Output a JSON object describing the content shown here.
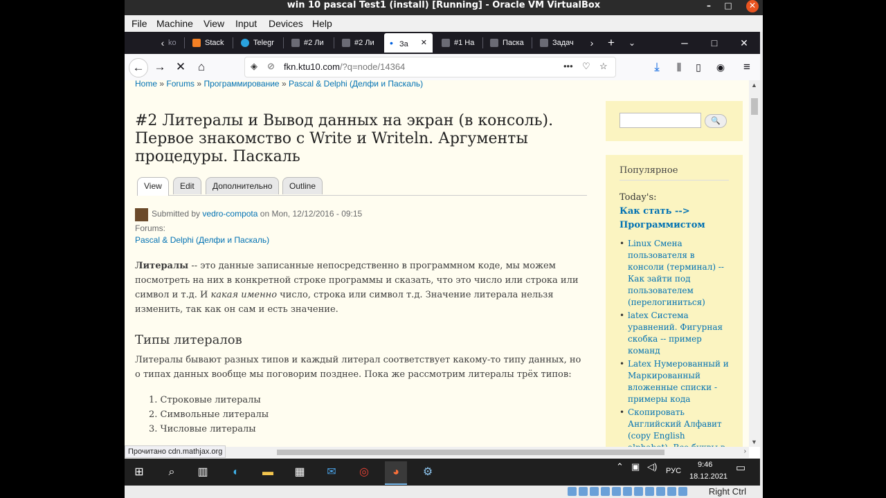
{
  "vbox": {
    "title": "win 10 pascal Test1 (install) [Running] - Oracle VM VirtualBox",
    "menu": [
      "File",
      "Machine",
      "View",
      "Input",
      "Devices",
      "Help"
    ],
    "host_key": "Right Ctrl"
  },
  "browser": {
    "tabs": [
      {
        "label": "ko"
      },
      {
        "label": "Stack"
      },
      {
        "label": "Telegr"
      },
      {
        "label": "#2 Ли"
      },
      {
        "label": "#2 Ли"
      },
      {
        "label": "За"
      },
      {
        "label": "#1 На"
      },
      {
        "label": "Паска"
      },
      {
        "label": "Задач"
      }
    ],
    "active_tab_index": 5,
    "url_host": "fkn.ktu10.com",
    "url_path": "/?q=node/14364",
    "status_text": "Прочитано cdn.mathjax.org"
  },
  "page": {
    "breadcrumb": {
      "home": "Home",
      "forums": "Forums",
      "programming": "Программирование",
      "pascal": "Pascal & Delphi (Делфи и Паскаль)",
      "sep": "»"
    },
    "title": "#2 Литералы и Вывод данных на экран (в консоль). Первое знакомство с Write и Writeln. Аргументы процедуры. Паскаль",
    "tabs": [
      "View",
      "Edit",
      "Дополнительно",
      "Outline"
    ],
    "submitted_prefix": "Submitted by",
    "author": "vedro-compota",
    "submitted_date": "on Mon, 12/12/2016 - 09:15",
    "forums_label": "Forums:",
    "forum_link": "Pascal & Delphi (Делфи и Паскаль)",
    "p1_bold": "Литералы",
    "p1_a": " -- это данные записанные непосредственно в программном коде, мы можем посмотреть на них в конкретной строке программы и сказать, что это число или строка или символ и т.д. И ",
    "p1_italic": "какая именно",
    "p1_b": " число, строка или символ т.д. Значение литерала нельзя изменить, так как он сам и есть значение.",
    "h2": "Типы литералов",
    "p2": "Литералы бывают разных типов и каждый литерал соответствует какому-то типу данных, но о типах данных вообще мы поговорим позднее. Пока же рассмотрим литералы трёх типов:",
    "list": [
      "1. Строковые литералы",
      "2. Символьные литералы",
      "3. Числовые литералы"
    ]
  },
  "sidebar": {
    "popular": "Популярное",
    "today_label": "Today's:",
    "today_link": "Как стать --> Программистом",
    "items": [
      "Linux Смена пользователя в консоли (терминал) -- Как зайти под пользователем (перелогиниться)",
      "latex Система уравнений. Фигурная скобка -- пример команд",
      "Latex Нумерованный и Маркированный вложенные списки - примеры кода",
      "Скопировать Английский Алфавит (copy English alphabet). Все буквы в строчку, в"
    ]
  },
  "taskbar": {
    "lang": "РУС",
    "time": "9:46",
    "date": "18.12.2021"
  }
}
